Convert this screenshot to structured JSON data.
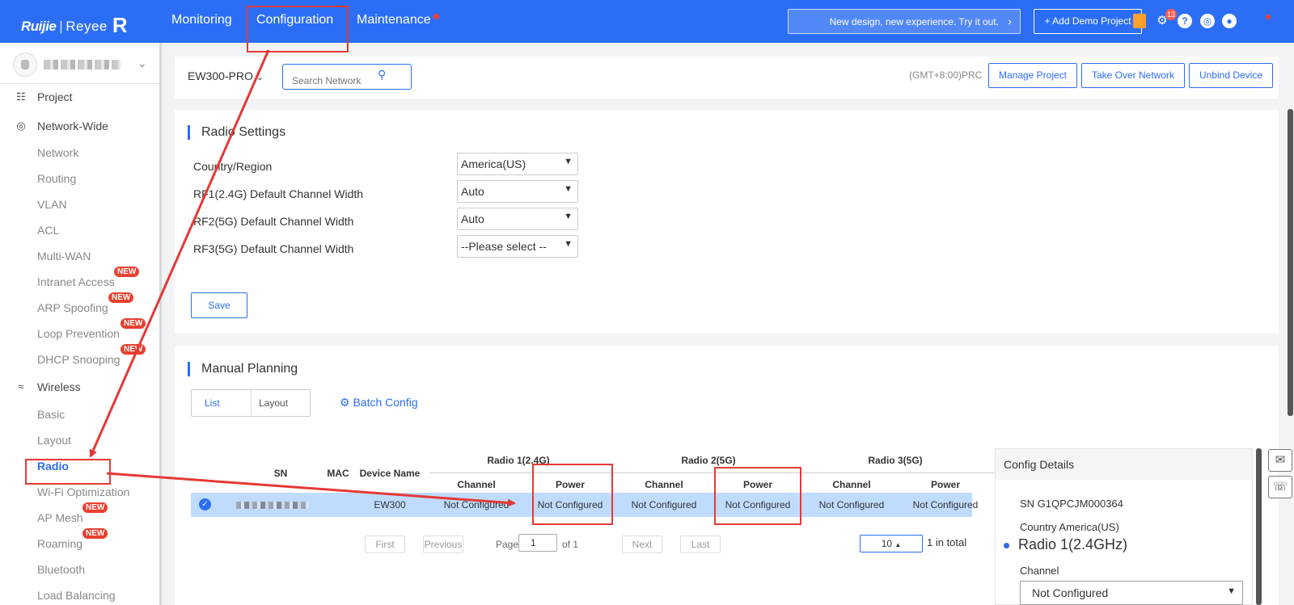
{
  "header": {
    "brand": "Ruijie",
    "brand_sub": "Reyee",
    "nav": [
      "Monitoring",
      "Configuration",
      "Maintenance"
    ],
    "promo": "New design, new experience. Try it out.",
    "demo_button": "+ Add Demo Project",
    "notification_count": "13",
    "icons": [
      "orders-icon",
      "settings-icon",
      "help-icon",
      "globe-icon",
      "user-icon"
    ]
  },
  "sidebar": {
    "items": [
      {
        "label": "Project",
        "type": "group",
        "icon": "project-icon"
      },
      {
        "label": "Network-Wide",
        "type": "group",
        "icon": "globe-icon"
      },
      {
        "label": "Network"
      },
      {
        "label": "Routing"
      },
      {
        "label": "VLAN"
      },
      {
        "label": "ACL"
      },
      {
        "label": "Multi-WAN"
      },
      {
        "label": "Intranet Access",
        "badge": "NEW"
      },
      {
        "label": "ARP Spoofing",
        "badge": "NEW"
      },
      {
        "label": "Loop Prevention",
        "badge": "NEW"
      },
      {
        "label": "DHCP Snooping",
        "badge": "NEW"
      },
      {
        "label": "Wireless",
        "type": "group",
        "icon": "wifi-icon"
      },
      {
        "label": "Basic"
      },
      {
        "label": "Layout"
      },
      {
        "label": "Radio",
        "active": true
      },
      {
        "label": "Wi-Fi Optimization"
      },
      {
        "label": "AP Mesh",
        "badge": "NEW"
      },
      {
        "label": "Roaming",
        "badge": "NEW"
      },
      {
        "label": "Bluetooth"
      },
      {
        "label": "Load Balancing"
      }
    ]
  },
  "toolbar": {
    "device": "EW300-PRO",
    "search_placeholder": "Search Network",
    "timezone": "(GMT+8:00)PRC",
    "manage_project": "Manage Project",
    "take_over": "Take Over Network",
    "unbind": "Unbind Device"
  },
  "radio_settings": {
    "title": "Radio Settings",
    "fields": [
      {
        "label": "Country/Region",
        "value": "America(US)"
      },
      {
        "label": "RF1(2.4G) Default Channel Width",
        "value": "Auto"
      },
      {
        "label": "RF2(5G) Default Channel Width",
        "value": "Auto"
      },
      {
        "label": "RF3(5G) Default Channel Width",
        "value": "--Please select --"
      }
    ],
    "save": "Save"
  },
  "manual_planning": {
    "title": "Manual Planning",
    "tabs": [
      "List",
      "Layout"
    ],
    "batch_config": "Batch Config",
    "columns": {
      "sn": "SN",
      "mac": "MAC",
      "device_name": "Device Name",
      "radio1": "Radio 1(2.4G)",
      "radio2": "Radio 2(5G)",
      "radio3": "Radio 3(5G)",
      "channel": "Channel",
      "power": "Power"
    },
    "rows": [
      {
        "device_name": "EW300",
        "r1_channel": "Not Configured",
        "r1_power": "Not Configured",
        "r2_channel": "Not Configured",
        "r2_power": "Not Configured",
        "r3_channel": "Not Configured",
        "r3_power": "Not Configured"
      }
    ],
    "pagination": {
      "first": "First",
      "previous": "Previous",
      "page_label": "Page",
      "page": "1",
      "of": "of 1",
      "next": "Next",
      "last": "Last",
      "page_size": "10",
      "total": "1 in total"
    }
  },
  "config_details": {
    "title": "Config Details",
    "sn": "SN G1QPCJM000364",
    "country": "Country America(US)",
    "radio": "Radio 1(2.4GHz)",
    "channel_label": "Channel",
    "channel_value": "Not Configured"
  },
  "colors": {
    "primary": "#2b6ef5",
    "highlight": "#e53935",
    "new_badge": "#e8412f"
  }
}
